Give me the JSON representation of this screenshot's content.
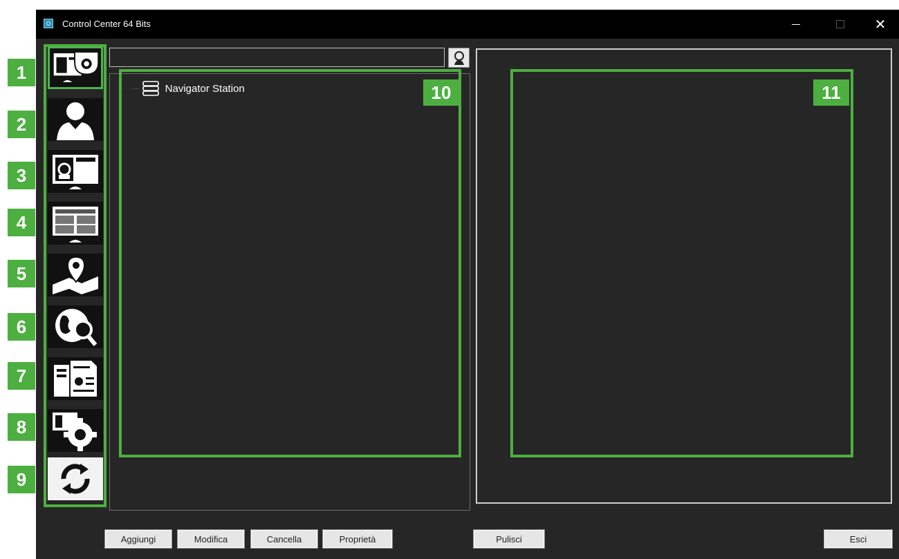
{
  "window": {
    "title": "Control Center 64 Bits"
  },
  "nav": {
    "items": [
      {
        "name": "cameras-monitor",
        "icon": "monitor-camera-icon",
        "number": "1"
      },
      {
        "name": "users",
        "icon": "user-icon",
        "number": "2"
      },
      {
        "name": "events-monitor",
        "icon": "alarm-monitor-icon",
        "number": "3"
      },
      {
        "name": "layouts",
        "icon": "layout-grid-icon",
        "number": "4"
      },
      {
        "name": "maps",
        "icon": "map-pin-icon",
        "number": "5"
      },
      {
        "name": "web-search",
        "icon": "globe-search-icon",
        "number": "6"
      },
      {
        "name": "reports",
        "icon": "documents-icon",
        "number": "7"
      },
      {
        "name": "settings",
        "icon": "settings-gear-icon",
        "number": "8"
      },
      {
        "name": "refresh",
        "icon": "refresh-icon",
        "number": "9"
      }
    ]
  },
  "search": {
    "value": ""
  },
  "tree": {
    "items": [
      {
        "label": "Navigator Station",
        "icon": "server-icon"
      }
    ]
  },
  "callouts": {
    "tree": "10",
    "details": "11"
  },
  "buttons": {
    "add": "Aggiungi",
    "edit": "Modifica",
    "delete": "Cancella",
    "properties": "Proprietà",
    "clear": "Pulisci",
    "exit": "Esci"
  },
  "colors": {
    "accent_green": "#4caf40",
    "background": "#262626",
    "titlebar": "#000000"
  }
}
